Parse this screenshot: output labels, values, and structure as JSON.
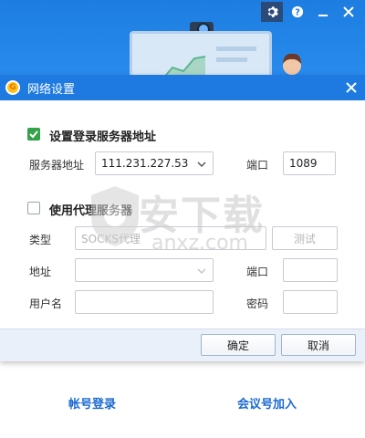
{
  "dialog": {
    "title": "网络设置",
    "icon": "app-logo-icon",
    "server_section": {
      "checked": true,
      "label": "设置登录服务器地址",
      "address_label": "服务器地址",
      "address_value": "111.231.227.53",
      "port_label": "端口",
      "port_value": "1089"
    },
    "proxy_section": {
      "checked": false,
      "label": "使用代理服务器",
      "type_label": "类型",
      "type_value": "SOCKS代理",
      "test_button": "测试",
      "address_label": "地址",
      "address_value": "",
      "port_label": "端口",
      "port_value": "",
      "username_label": "用户名",
      "username_value": "",
      "password_label": "密码",
      "password_value": ""
    },
    "buttons": {
      "ok": "确定",
      "cancel": "取消"
    }
  },
  "background": {
    "account_login": "帐号登录",
    "meeting_join": "会议号加入",
    "window_icons": [
      "gear-icon",
      "help-icon",
      "minimize-icon",
      "close-icon"
    ]
  },
  "watermark": {
    "brand": "安下载",
    "domain": "anxz.com"
  },
  "colors": {
    "titlebar": "#1e7ae0",
    "header_bg": "#2b8ef0",
    "checkbox_checked": "#34a24a",
    "link": "#1a69d0",
    "footer": "#e9f0f9"
  }
}
